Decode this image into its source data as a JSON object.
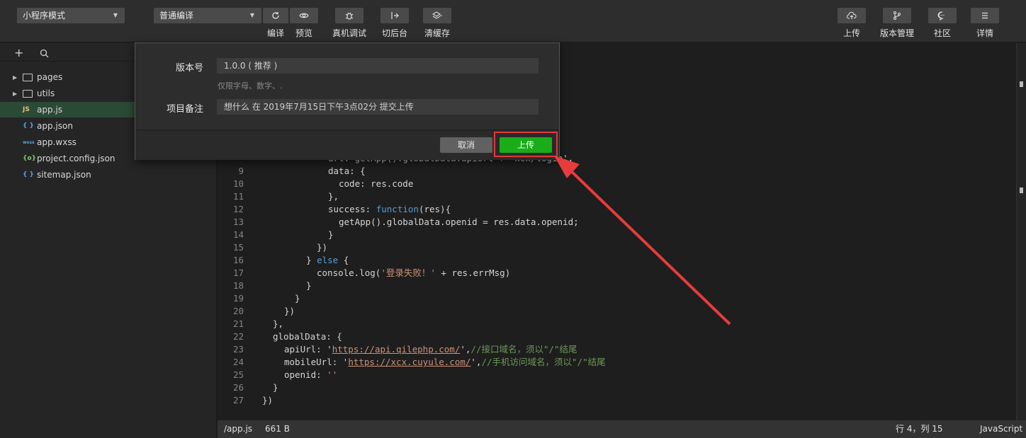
{
  "toolbar": {
    "mode_select": "小程序模式",
    "compile_select": "普通编译",
    "buttons": {
      "compile": "编译",
      "preview": "预览",
      "remote_debug": "真机调试",
      "background": "切后台",
      "clear_cache": "清缓存",
      "upload": "上传",
      "version_mgmt": "版本管理",
      "community": "社区",
      "details": "详情"
    }
  },
  "sidebar": {
    "items": [
      {
        "label": "pages",
        "type": "folder"
      },
      {
        "label": "utils",
        "type": "folder"
      },
      {
        "label": "app.js",
        "type": "js",
        "icon_text": "JS"
      },
      {
        "label": "app.json",
        "type": "json",
        "icon_text": "{ }"
      },
      {
        "label": "app.wxss",
        "type": "wxss",
        "icon_text": "wxss"
      },
      {
        "label": "project.config.json",
        "type": "config",
        "icon_text": "{o}"
      },
      {
        "label": "sitemap.json",
        "type": "json",
        "icon_text": "{ }"
      }
    ]
  },
  "editor": {
    "lines": [
      {
        "n": "9"
      },
      {
        "n": "10"
      },
      {
        "n": "11"
      },
      {
        "n": "12"
      },
      {
        "n": "13"
      },
      {
        "n": "14"
      },
      {
        "n": "15"
      },
      {
        "n": "16"
      },
      {
        "n": "17"
      },
      {
        "n": "18"
      },
      {
        "n": "19"
      },
      {
        "n": "20"
      },
      {
        "n": "21"
      },
      {
        "n": "22"
      },
      {
        "n": "23"
      },
      {
        "n": "24"
      },
      {
        "n": "25"
      },
      {
        "n": "26"
      },
      {
        "n": "27"
      }
    ],
    "partial_line": "url: getApp().globalData.apiUrl + 'xcx/login',",
    "code": {
      "l9": "data: {",
      "l10": "code: res.code",
      "l11": "},",
      "l12_a": "success: ",
      "l12_kw": "function",
      "l12_b": "(res){",
      "l13": "getApp().globalData.openid = res.data.openid;",
      "l14": "}",
      "l15": "})",
      "l16_a": "} ",
      "l16_kw": "else",
      "l16_b": " {",
      "l17_a": "console.log(",
      "l17_str": "'登录失败！'",
      "l17_b": " + res.errMsg)",
      "l18": "}",
      "l19": "}",
      "l20": "})",
      "l21": "},",
      "l22": "globalData: {",
      "l23_a": "apiUrl: '",
      "l23_url": "https://api.qilephp.com/",
      "l23_b": "',",
      "l23_cm": "//接口域名，须以\"/\"结尾",
      "l24_a": "mobileUrl: '",
      "l24_url": "https://xcx.cuyule.com/",
      "l24_b": "',",
      "l24_cm": "//手机访问域名，须以\"/\"结尾",
      "l25_a": "openid: ",
      "l25_str": "''",
      "l26": "}",
      "l27": "})"
    }
  },
  "statusbar": {
    "path": "/app.js",
    "size": "661 B",
    "position": "行 4，列 15",
    "language": "JavaScript"
  },
  "dialog": {
    "version_label": "版本号",
    "version_value": "1.0.0 ( 推荐 )",
    "version_hint": "仅限字母、数字、.",
    "note_label": "项目备注",
    "note_value": "想什么 在 2019年7月15日下午3点02分 提交上传",
    "cancel": "取消",
    "upload": "上传"
  },
  "colors": {
    "accent_green": "#1aad19",
    "annotation_red": "#e03a3a"
  }
}
